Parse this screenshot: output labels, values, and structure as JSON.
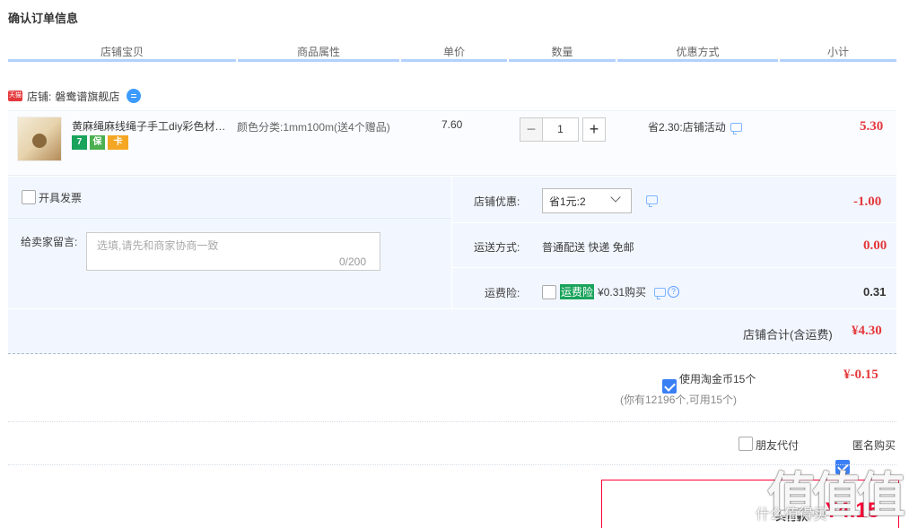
{
  "page_title": "确认订单信息",
  "columns": [
    "店铺宝贝",
    "商品属性",
    "单价",
    "数量",
    "优惠方式",
    "小计"
  ],
  "shop": {
    "badge": "天猫",
    "label": "店铺:",
    "name": "磐鸯谱旗舰店"
  },
  "item": {
    "title": "黄麻绳麻线绳子手工diy彩色材…",
    "badges": [
      "7",
      "保",
      "卡"
    ],
    "attr": "颜色分类:1mm100m(送4个赠品)",
    "unit_price": "7.60",
    "qty": "1",
    "qty_minus": "−",
    "qty_plus": "+",
    "discount": "省2.30:店铺活动",
    "subtotal": "5.30"
  },
  "invoice": {
    "label": "开具发票"
  },
  "memo": {
    "label": "给卖家留言:",
    "placeholder": "选填,请先和商家协商一致",
    "count": "0/200"
  },
  "shop_discount": {
    "label": "店铺优惠:",
    "selected": "省1元:2",
    "amount": "-1.00"
  },
  "shipping": {
    "label": "运送方式:",
    "value": "普通配送 快递 免邮",
    "amount": "0.00"
  },
  "insurance": {
    "label": "运费险:",
    "tag": "运费险",
    "price_text": "¥0.31购买",
    "help": "?",
    "amount": "0.31"
  },
  "shop_total": {
    "label": "店铺合计(含运费)",
    "amount": "¥4.30"
  },
  "coins": {
    "label": "使用淘金币15个",
    "note": "(你有12196个,可用15个)",
    "amount": "¥-0.15"
  },
  "options": {
    "friend_pay": "朋友代付",
    "anonymous": "匿名购买"
  },
  "pay": {
    "label": "实付款:",
    "amount": "¥4.15"
  },
  "watermark": {
    "text": "值值值",
    "sub": "什么值得买"
  },
  "colors": {
    "accent_red": "#e4393c",
    "header_line": "#b2d1ff",
    "panel_bg": "#f2f7ff",
    "check_blue": "#3b7ff5"
  }
}
